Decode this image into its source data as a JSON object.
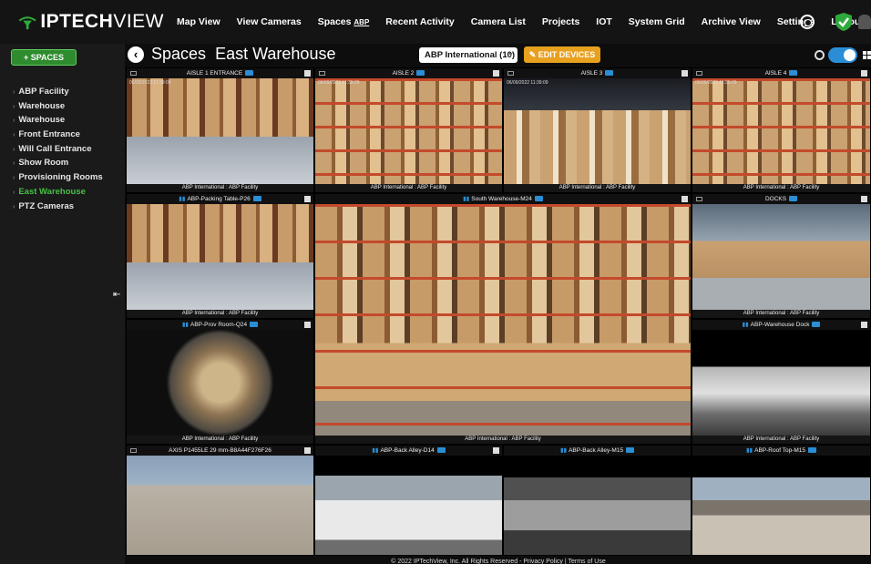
{
  "app": {
    "brand_bold": "IPTECH",
    "brand_light": "VIEW",
    "brand_color": "#2eaa3c"
  },
  "nav": {
    "items": [
      {
        "label": "Map View"
      },
      {
        "label": "View Cameras"
      },
      {
        "label": "Spaces",
        "tag": "ABP"
      },
      {
        "label": "Recent Activity"
      },
      {
        "label": "Camera List"
      },
      {
        "label": "Projects"
      },
      {
        "label": "IOT"
      },
      {
        "label": "System Grid"
      },
      {
        "label": "Archive View"
      },
      {
        "label": "Settings"
      },
      {
        "label": "Logout"
      }
    ],
    "icons": [
      "gear-icon",
      "shield-check-icon",
      "bell-icon"
    ]
  },
  "sidebar": {
    "spaces_button": "+ SPACES",
    "items": [
      {
        "label": "ABP Facility"
      },
      {
        "label": "Warehouse"
      },
      {
        "label": "Warehouse"
      },
      {
        "label": "Front Entrance"
      },
      {
        "label": "Will Call Entrance"
      },
      {
        "label": "Show Room"
      },
      {
        "label": "Provisioning Rooms"
      },
      {
        "label": "East Warehouse",
        "active": true
      },
      {
        "label": "PTZ Cameras"
      }
    ],
    "active_color": "#48c048"
  },
  "header": {
    "title_prefix": "Spaces",
    "title_space": "East Warehouse",
    "org_select": "ABP International (10)",
    "edit_button": "EDIT DEVICES",
    "accent": "#e8a01f",
    "toggle_on": true
  },
  "cameras": [
    {
      "name": "AISLE 1 ENTRANCE",
      "location": "ABP International : ABP Facility"
    },
    {
      "name": "AISLE 2",
      "location": "ABP International : ABP Facility"
    },
    {
      "name": "AISLE 3",
      "location": "ABP International : ABP Facility"
    },
    {
      "name": "AISLE 4",
      "location": "ABP International : ABP Facility"
    },
    {
      "name": "ABP-Packing Table-P26",
      "location": "ABP International : ABP Facility"
    },
    {
      "name": "South Warehouse-M24",
      "location": "ABP International : ABP Facility"
    },
    {
      "name": "DOCKS",
      "location": "ABP International : ABP Facility"
    },
    {
      "name": "ABP-Prov Room-Q24",
      "location": "ABP International : ABP Facility"
    },
    {
      "name": "ABP-Warehouse Dock",
      "location": "ABP International : ABP Facility"
    },
    {
      "name": "AXIS P1455LE 29 mm-B8A44F276F26",
      "location": ""
    },
    {
      "name": "ABP-Back Alley-D14",
      "location": ""
    },
    {
      "name": "ABP-Back Alley-M15",
      "location": ""
    },
    {
      "name": "ABP-Roof Top-M15",
      "location": ""
    }
  ],
  "timestamp": "06/09/2022 11:39:09",
  "footer": "© 2022 IPTechView, Inc. All Rights Reserved - Privacy Policy | Terms of Use"
}
